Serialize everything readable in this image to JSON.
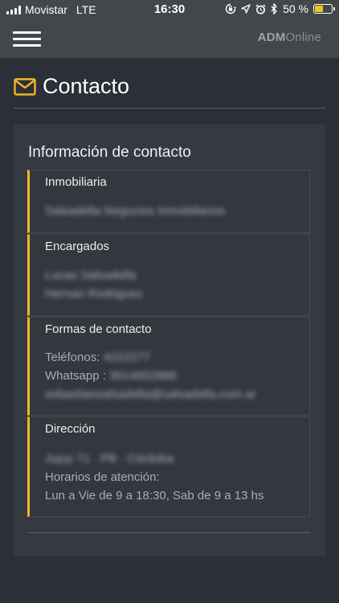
{
  "status_bar": {
    "carrier": "Movistar",
    "network": "LTE",
    "time": "16:30",
    "battery_percent": "50 %",
    "battery_level": 0.5,
    "battery_color": "#f2c229",
    "icons": [
      "signal-icon",
      "lock-rotation-icon",
      "location-arrow-icon",
      "alarm-icon",
      "bluetooth-icon",
      "battery-icon"
    ]
  },
  "header": {
    "brand_bold": "ADM",
    "brand_rest": "Online",
    "menu_icon": "hamburger-menu-icon"
  },
  "page": {
    "title": "Contacto",
    "title_icon": "envelope-icon",
    "accent_color": "#f1b52a"
  },
  "card": {
    "heading": "Información de contacto",
    "sections": [
      {
        "title": "Inmobiliaria",
        "lines": [
          "Salsadella Negocios Inmobiliarios"
        ]
      },
      {
        "title": "Encargados",
        "lines": [
          "Lucas Salsadella",
          "Hernan Rodriguez"
        ]
      },
      {
        "title": "Formas de contacto",
        "phones_label": "Teléfonos:",
        "phones_value": "4222277",
        "whatsapp_label": "Whatsapp :",
        "whatsapp_value": "3614602888",
        "email": "sebastiansalsadella@salsadella.com.ar"
      },
      {
        "title": "Dirección",
        "address": "Jujuy 71 · PB · Córdoba",
        "hours_label": "Horarios de atención:",
        "hours_value": "Lun a Vie de 9 a 18:30, Sab de 9 a 13 hs"
      }
    ]
  }
}
